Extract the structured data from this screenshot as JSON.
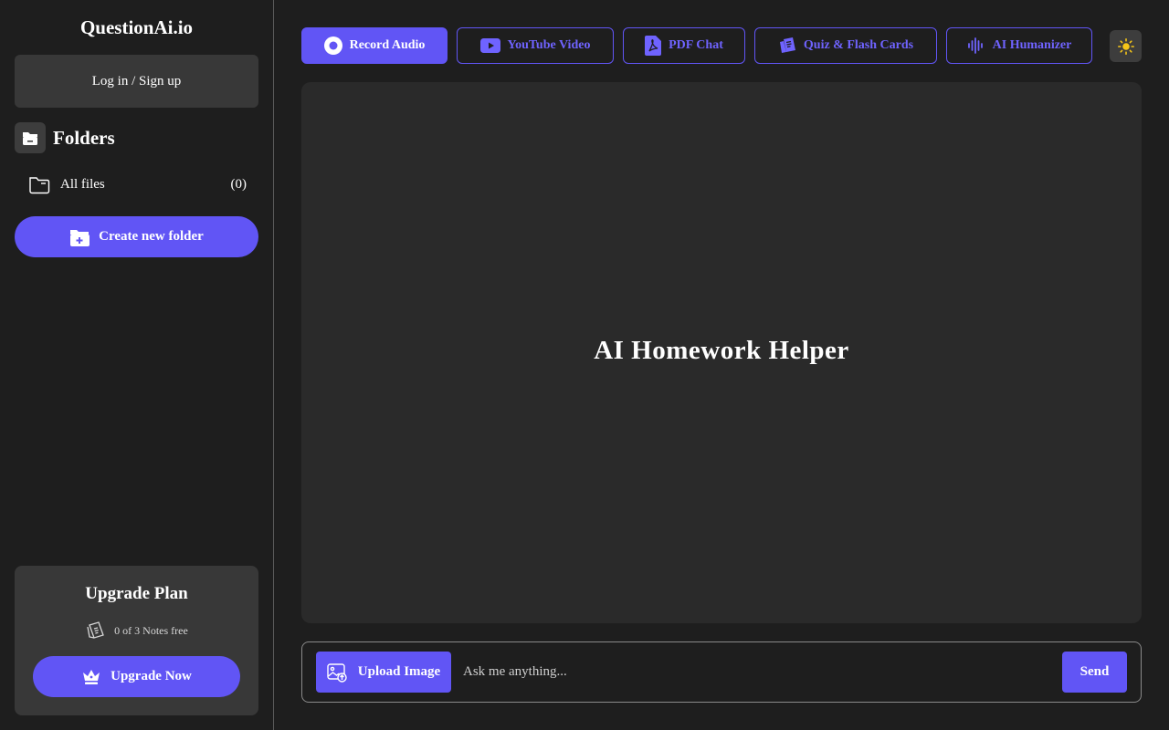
{
  "app": {
    "brand": "QuestionAi.io"
  },
  "sidebar": {
    "login_label": "Log in / Sign up",
    "folders_title": "Folders",
    "all_files_label": "All files",
    "all_files_count": "(0)",
    "create_folder_label": "Create new folder",
    "upgrade": {
      "title": "Upgrade Plan",
      "notes_free": "0 of 3 Notes free",
      "button_label": "Upgrade Now"
    }
  },
  "toolbar": {
    "tabs": [
      {
        "label": "Record Audio",
        "icon": "record-icon",
        "active": true
      },
      {
        "label": "YouTube Video",
        "icon": "youtube-icon",
        "active": false
      },
      {
        "label": "PDF Chat",
        "icon": "pdf-icon",
        "active": false
      },
      {
        "label": "Quiz & Flash Cards",
        "icon": "cards-icon",
        "active": false
      },
      {
        "label": "AI Humanizer",
        "icon": "waveform-icon",
        "active": false
      }
    ],
    "theme_icon": "sun-icon"
  },
  "main": {
    "title": "AI Homework Helper"
  },
  "composer": {
    "upload_label": "Upload Image",
    "input_placeholder": "Ask me anything...",
    "input_value": "",
    "send_label": "Send"
  },
  "colors": {
    "accent": "#6155f5",
    "background": "#1e1e1e",
    "panel": "#2a2a2a",
    "card": "#383838",
    "sun": "#f5c518"
  }
}
